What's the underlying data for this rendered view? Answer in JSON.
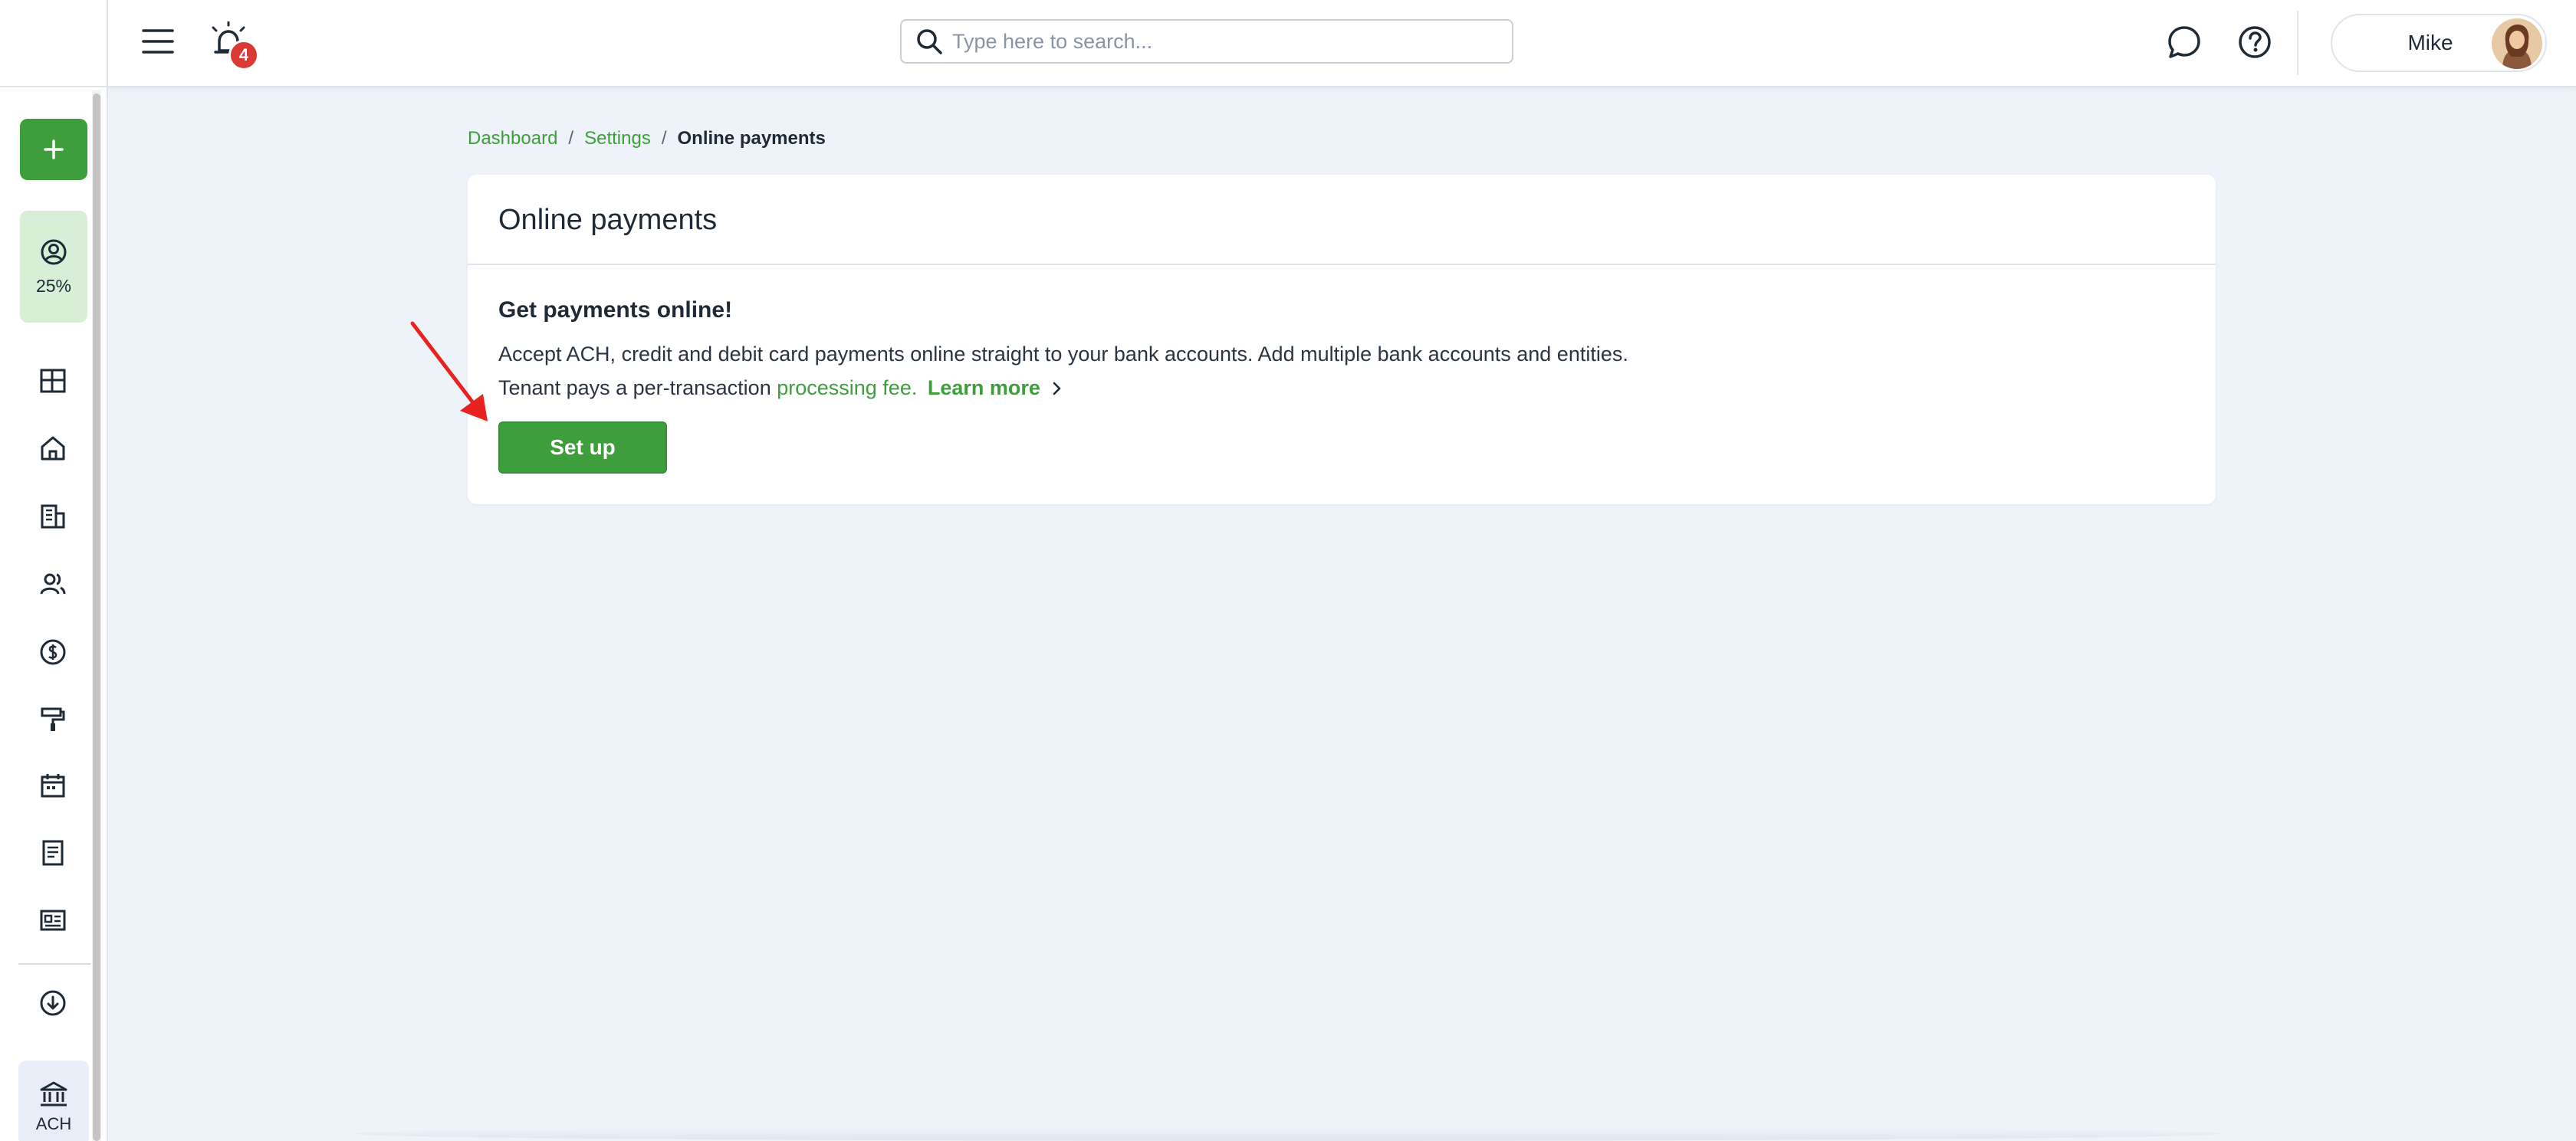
{
  "header": {
    "notification_count": "4",
    "search_placeholder": "Type here to search...",
    "user_name": "Mike"
  },
  "sidebar": {
    "profile_completion": "25%",
    "ach_label": "ACH",
    "nav_icons": [
      "dashboard-icon",
      "home-icon",
      "building-icon",
      "people-icon",
      "dollar-icon",
      "paint-roller-icon",
      "calendar-icon",
      "document-icon",
      "id-card-icon",
      "download-cloud-icon",
      "bank-icon"
    ]
  },
  "breadcrumb": {
    "items": [
      "Dashboard",
      "Settings",
      "Online payments"
    ],
    "separator": "/"
  },
  "card": {
    "title": "Online payments",
    "subtitle": "Get payments online!",
    "description": "Accept ACH, credit and debit card payments online straight to your bank accounts. Add multiple bank accounts and entities. Tenant pays a per-transaction",
    "fee_link": "processing fee.",
    "learn_more": "Learn more",
    "setup_button": "Set up"
  },
  "colors": {
    "accent": "#3e9e3b",
    "badge": "#d93a35",
    "background": "#eef2f9",
    "annotation_arrow": "#e8231f"
  }
}
